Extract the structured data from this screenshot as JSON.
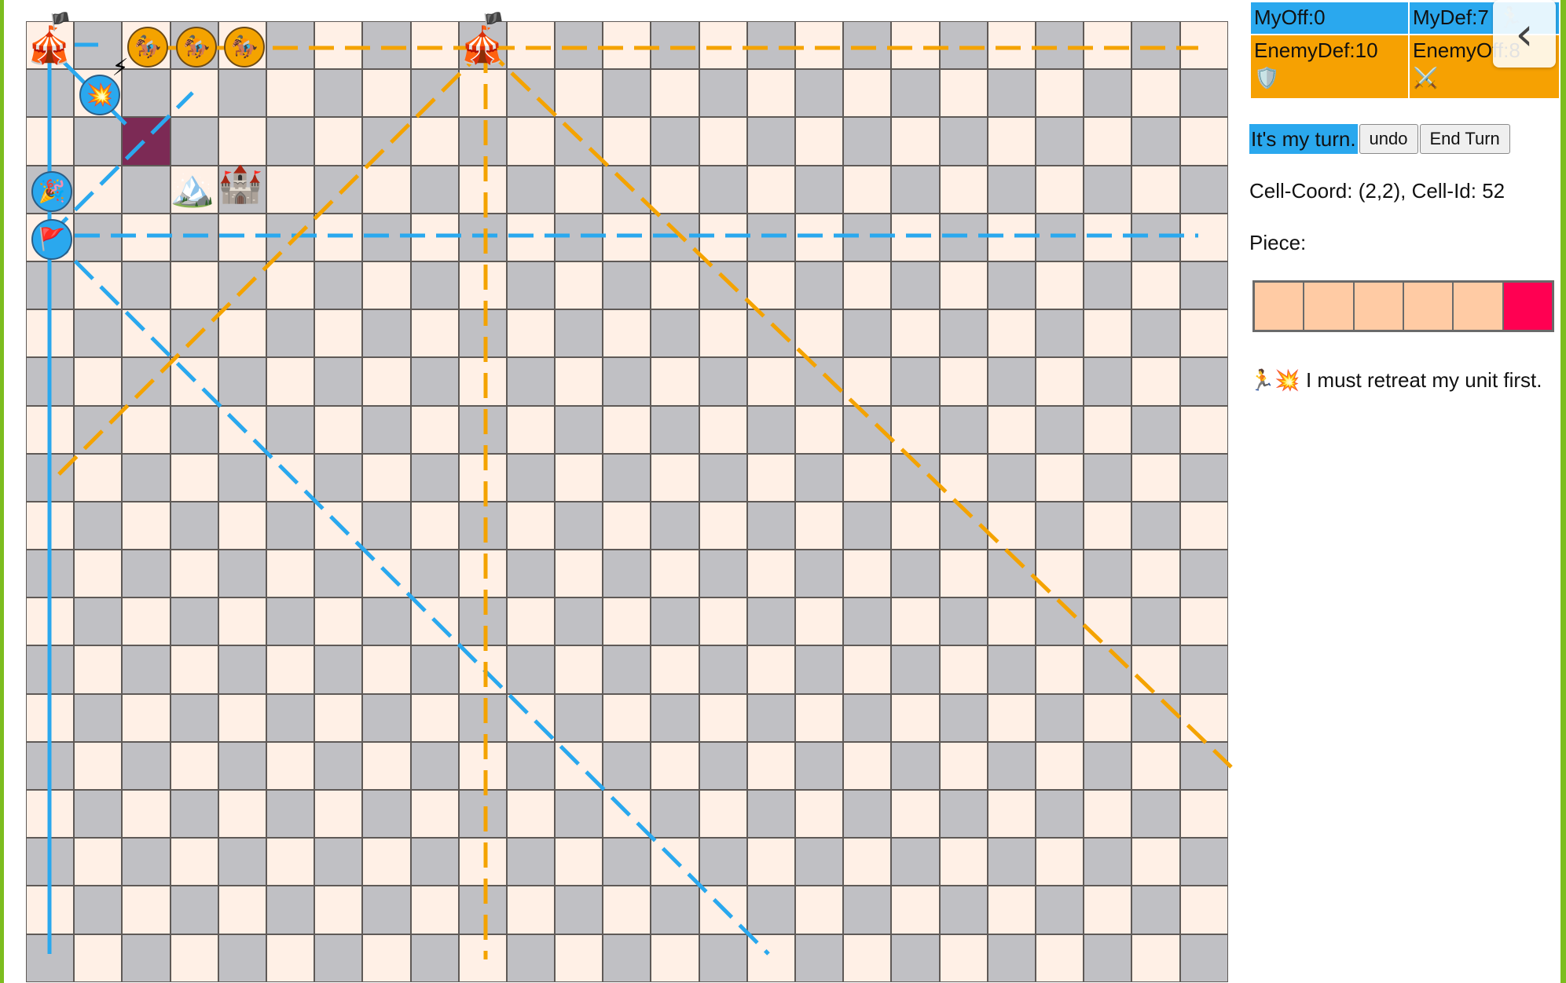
{
  "board": {
    "cols": 25,
    "rows": 20,
    "colors": {
      "light": "#fff0e6",
      "dark": "#c0c0c4",
      "selected": "#7c2a55",
      "grid": "#5f5a57"
    },
    "selected_cell": {
      "col": 2,
      "row": 2
    },
    "routes": {
      "blue": "#2aa8ee",
      "orange": "#f4a300"
    }
  },
  "pieces": {
    "circus_top_left": "🎪",
    "circus_top_center": "🎪",
    "teal_flag_left": "🏴",
    "teal_flag_center": "🏴",
    "rider_1": "🏇",
    "rider_2": "🏇",
    "rider_3": "🏇",
    "explosion": "💥",
    "lightning": "⚡",
    "mountain": "🏔️",
    "castle": "🏰",
    "confetti": "🎉",
    "red_flag": "🚩"
  },
  "stats": {
    "my_off": "MyOff:0",
    "my_def": "MyDef:7",
    "enemy_def": "EnemyDef:10",
    "enemy_off": "EnemyOff:8",
    "enemy_def_icon": "🛡️",
    "enemy_off_icon": "⚔️",
    "runner_icon": "🏃",
    "colors": {
      "mine": "#2aa8ee",
      "enemy": "#f6a102"
    }
  },
  "nav": {
    "back_icon": "‹"
  },
  "turn": {
    "label": "It's my turn.",
    "undo_label": "undo",
    "end_turn_label": "End Turn"
  },
  "cell_info": "Cell-Coord: (2,2), Cell-Id: 52",
  "piece_label": "Piece:",
  "piece_strip": [
    "#ffcba4",
    "#ffcba4",
    "#ffcba4",
    "#ffcba4",
    "#ffcba4",
    "#ff0052"
  ],
  "message": {
    "icons": "🏃💥",
    "text": "I must retreat my unit first."
  }
}
